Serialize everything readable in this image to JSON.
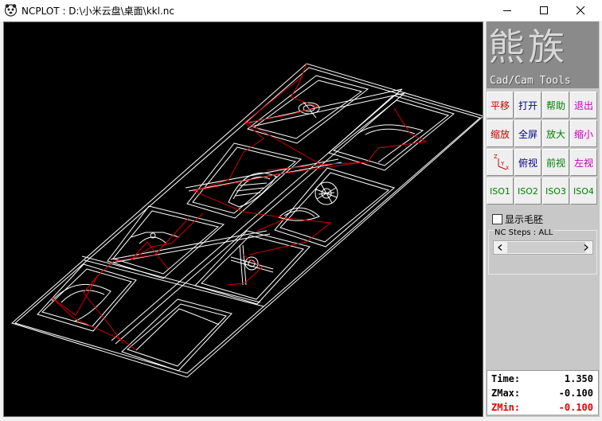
{
  "window": {
    "title": "NCPLOT : D:\\小米云盘\\桌面\\kkl.nc",
    "app_icon": "ncplot-app-icon",
    "controls": [
      "minimize-icon",
      "maximize-icon",
      "close-icon"
    ]
  },
  "logo": {
    "chinese": "熊族",
    "english": "Cad/Cam Tools"
  },
  "toolbar": {
    "buttons": [
      {
        "label": "平移",
        "color": "#c00000"
      },
      {
        "label": "打开",
        "color": "#000080"
      },
      {
        "label": "帮助",
        "color": "#008000"
      },
      {
        "label": "退出",
        "color": "#c000c0"
      },
      {
        "label": "缩放",
        "color": "#c00000"
      },
      {
        "label": "全屏",
        "color": "#000080"
      },
      {
        "label": "放大",
        "color": "#008000"
      },
      {
        "label": "缩小",
        "color": "#c000c0"
      },
      {
        "label": "",
        "icon": "axes-icon"
      },
      {
        "label": "俯视",
        "color": "#000080"
      },
      {
        "label": "前视",
        "color": "#008000"
      },
      {
        "label": "左视",
        "color": "#c000c0"
      },
      {
        "label": "ISO1",
        "color": "#008000"
      },
      {
        "label": "ISO2",
        "color": "#008000"
      },
      {
        "label": "ISO3",
        "color": "#008000"
      },
      {
        "label": "ISO4",
        "color": "#008000"
      }
    ]
  },
  "stock_checkbox": {
    "label": "显示毛胚",
    "checked": false
  },
  "nc_steps": {
    "label": "NC Steps : ALL"
  },
  "stats": {
    "time_label": "Time:",
    "time_value": "1.350",
    "zmax_label": "ZMax:",
    "zmax_value": "-0.100",
    "zmin_label": "ZMin:",
    "zmin_value": "-0.100",
    "zmin_color": "#e00000"
  },
  "plot": {
    "toolpath_color": "#ffffff",
    "rapid_color": "#d00000",
    "background": "#000000"
  }
}
